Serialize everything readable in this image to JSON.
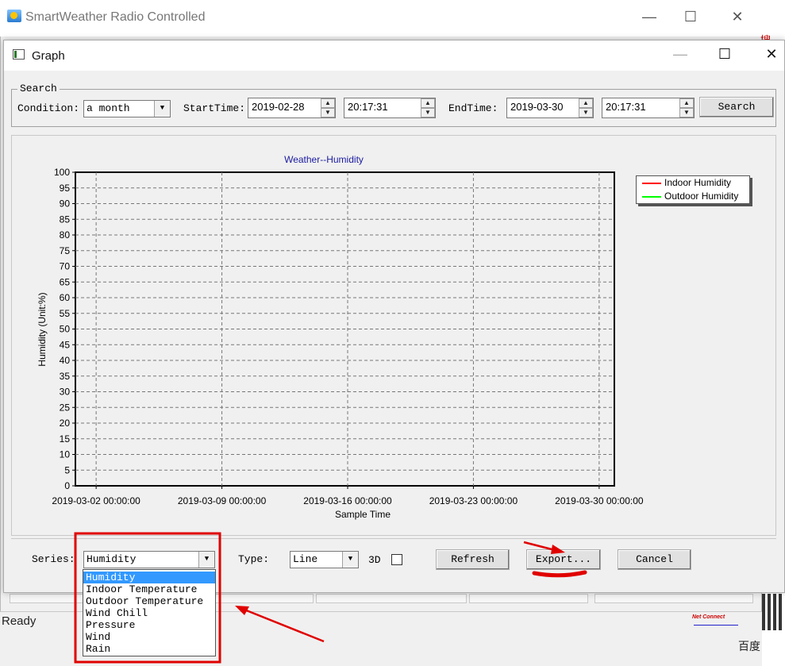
{
  "bg_window": {
    "title": "SmartWeather Radio Controlled",
    "status": "Ready"
  },
  "bg_side": {
    "top_char": "搜",
    "qr_caption": "百度",
    "badge": "Net Connect"
  },
  "dialog": {
    "title": "Graph"
  },
  "search": {
    "legend": "Search",
    "condition_label": "Condition:",
    "condition_value": "a month",
    "start_label": "StartTime:",
    "start_date": "2019-02-28",
    "start_time": "20:17:31",
    "end_label": "EndTime:",
    "end_date": "2019-03-30",
    "end_time": "20:17:31",
    "search_button": "Search"
  },
  "chart_data": {
    "type": "line",
    "title": "Weather--Humidity",
    "xlabel": "Sample Time",
    "ylabel": "Humidity (Unit:%)",
    "ylim": [
      0,
      100
    ],
    "yticks": [
      "0",
      "5",
      "10",
      "15",
      "20",
      "25",
      "30",
      "35",
      "40",
      "45",
      "50",
      "55",
      "60",
      "65",
      "70",
      "75",
      "80",
      "85",
      "90",
      "95",
      "100"
    ],
    "xticks": [
      "2019-03-02 00:00:00",
      "2019-03-09 00:00:00",
      "2019-03-16 00:00:00",
      "2019-03-23 00:00:00",
      "2019-03-30 00:00:00"
    ],
    "grid": true,
    "legend_position": "top-right",
    "series": [
      {
        "name": "Indoor Humidity",
        "color": "#ff0000",
        "values": []
      },
      {
        "name": "Outdoor Humidity",
        "color": "#00ff00",
        "values": []
      }
    ]
  },
  "controls": {
    "series_label": "Series:",
    "series_value": "Humidity",
    "series_options": [
      "Humidity",
      "Indoor Temperature",
      "Outdoor Temperature",
      "Wind Chill",
      "Pressure",
      "Wind",
      "Rain"
    ],
    "type_label": "Type:",
    "type_value": "Line",
    "three_d_label": "3D",
    "three_d_checked": false,
    "refresh_button": "Refresh",
    "export_button": "Export...",
    "cancel_button": "Cancel"
  },
  "annotation": {
    "color": "#e00000"
  }
}
